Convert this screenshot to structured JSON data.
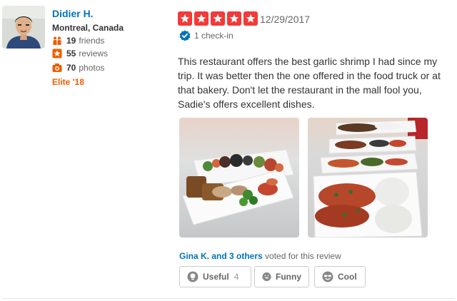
{
  "user": {
    "name": "Didier H.",
    "location": "Montreal, Canada",
    "friends_count": "19",
    "friends_label": "friends",
    "reviews_count": "55",
    "reviews_label": "reviews",
    "photos_count": "70",
    "photos_label": "photos",
    "elite": "Elite '18"
  },
  "review": {
    "rating": 5,
    "date": "12/29/2017",
    "checkin": "1 check-in",
    "text": "This restaurant offers the best garlic shrimp I had since my trip. It was better then the one offered in the food truck or at that bakery. Don't let the restaurant in the mall fool you, Sadie's offers excellent dishes."
  },
  "votes": {
    "voters": "Gina K. and 3 others",
    "suffix": "voted for this review",
    "useful_label": "Useful",
    "useful_count": "4",
    "funny_label": "Funny",
    "cool_label": "Cool"
  },
  "colors": {
    "star": "#f43939",
    "link": "#0073bb",
    "elite": "#f15c00"
  }
}
